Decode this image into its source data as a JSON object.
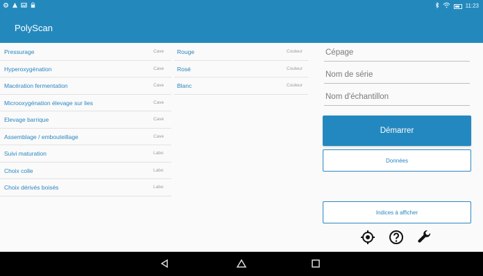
{
  "status_bar": {
    "left_icons": [
      "settings-icon",
      "alert-icon",
      "image-icon",
      "lock-icon"
    ],
    "right_icons": [
      "bluetooth-icon",
      "wifi-icon",
      "battery-icon"
    ],
    "time": "11:23"
  },
  "app": {
    "title": "PolyScan",
    "accent_color": "#2389bd"
  },
  "left_list": [
    {
      "label": "Pressurage",
      "type": "Cave"
    },
    {
      "label": "Hyperoxygénation",
      "type": "Cave"
    },
    {
      "label": "Macération fermentation",
      "type": "Cave"
    },
    {
      "label": "Microoxygénation élevage sur lies",
      "type": "Cave"
    },
    {
      "label": "Elevage barrique",
      "type": "Cave"
    },
    {
      "label": "Assemblage / embouteillage",
      "type": "Cave"
    },
    {
      "label": "Suivi maturation",
      "type": "Labo"
    },
    {
      "label": "Choix colle",
      "type": "Labo"
    },
    {
      "label": "Choix dérivés boisés",
      "type": "Labo"
    }
  ],
  "middle_list": [
    {
      "label": "Rouge",
      "type": "Couleur"
    },
    {
      "label": "Rosé",
      "type": "Couleur"
    },
    {
      "label": "Blanc",
      "type": "Couleur"
    }
  ],
  "form": {
    "cepage_placeholder": "Cépage",
    "serie_placeholder": "Nom de série",
    "echantillon_placeholder": "Nom d'échantillon"
  },
  "buttons": {
    "start": "Démarrer",
    "data": "Données",
    "indices": "Indices à afficher"
  },
  "toolbar_icons": [
    "gps-target-icon",
    "help-icon",
    "wrench-icon"
  ],
  "nav_icons": [
    "back-icon",
    "home-icon",
    "recents-icon"
  ]
}
